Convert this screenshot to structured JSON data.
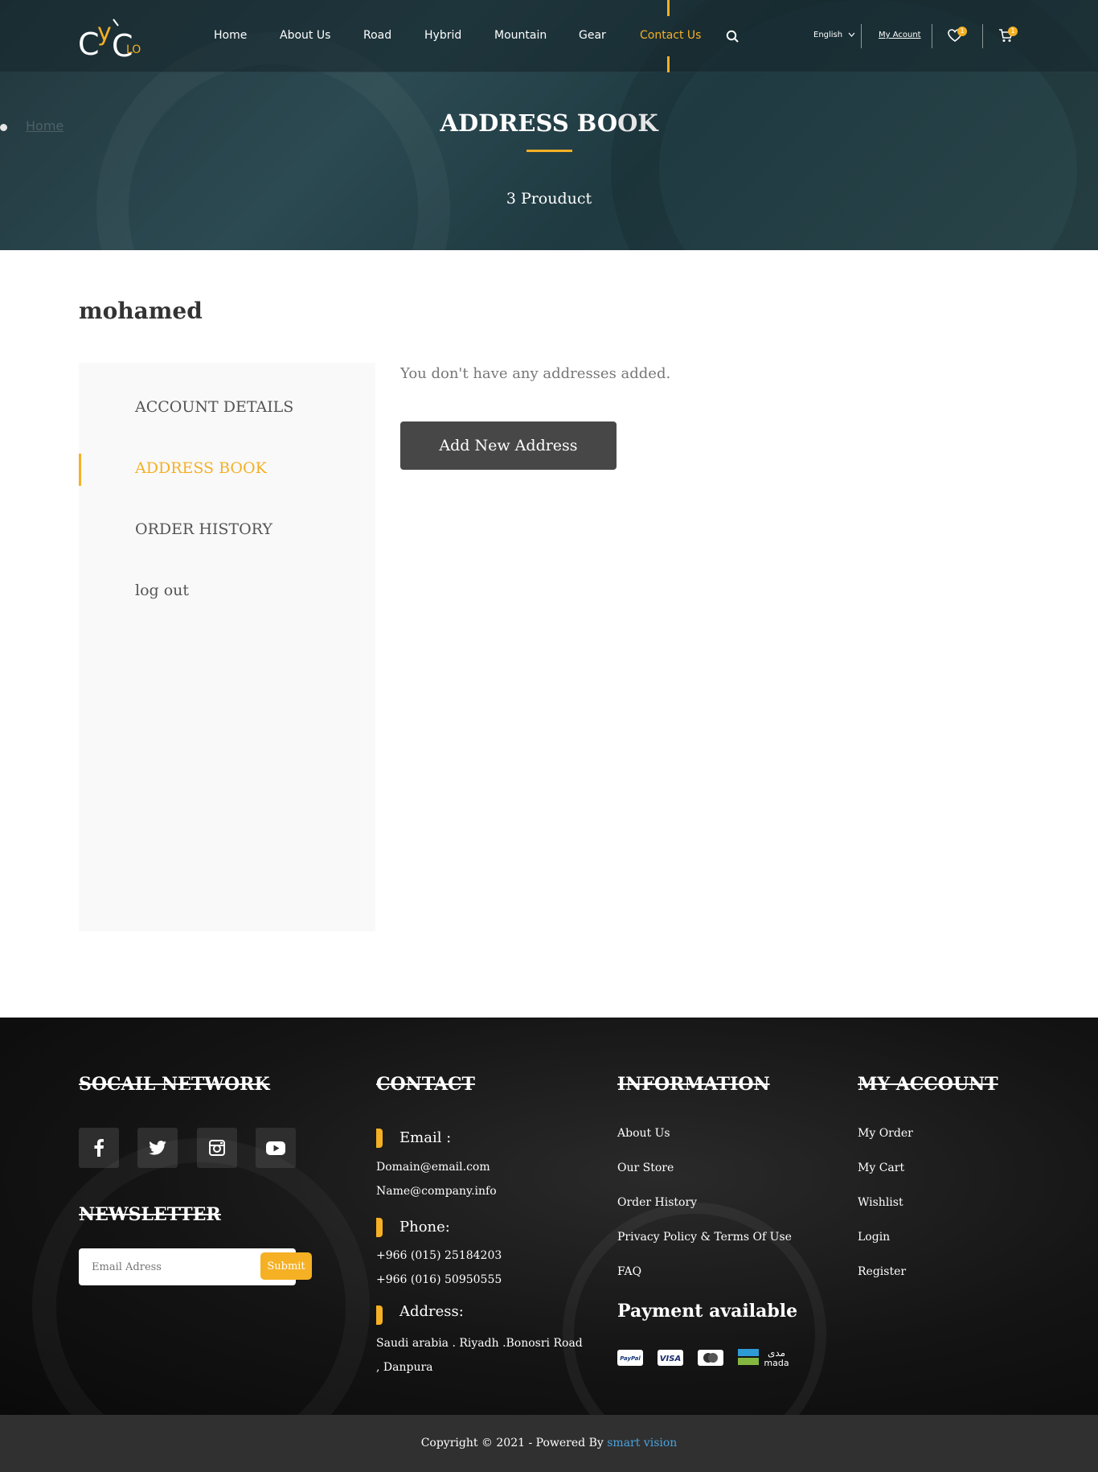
{
  "nav": {
    "items": [
      {
        "label": "Home"
      },
      {
        "label": "About Us"
      },
      {
        "label": "Road"
      },
      {
        "label": "Hybrid"
      },
      {
        "label": "Mountain"
      },
      {
        "label": "Gear"
      },
      {
        "label": "Contact Us",
        "active": true
      }
    ],
    "language": "English",
    "account": "My Acount",
    "wishlist_count": "1",
    "cart_count": "1",
    "accent_color": "#f5b024"
  },
  "logo": {
    "letters": [
      "C",
      "y",
      "C",
      "LO"
    ]
  },
  "breadcrumb": {
    "label": "Home"
  },
  "hero": {
    "title": "ADDRESS BOOK",
    "subtitle": "3 Prouduct"
  },
  "user": {
    "name": "mohamed"
  },
  "sidebar": {
    "items": [
      {
        "label": "ACCOUNT DETAILS"
      },
      {
        "label": "ADDRESS BOOK",
        "active": true
      },
      {
        "label": "ORDER HISTORY"
      },
      {
        "label": "log out"
      }
    ]
  },
  "main": {
    "empty_message": "You don't have any addresses added.",
    "add_button": "Add  New Address"
  },
  "footer": {
    "social_heading": "SOCAIL NETWORK",
    "social_icons": [
      "facebook-icon",
      "twitter-icon",
      "instagram-icon",
      "youtube-icon"
    ],
    "newsletter_heading": "NEWSLETTER",
    "newsletter_placeholder": "Email Adress",
    "newsletter_submit": "Submit",
    "contact_heading": "CONTACT",
    "email_label": "Email :",
    "email_1": "Domain@email.com",
    "email_2": "Name@company.info",
    "phone_label": "Phone:",
    "phone_1": "+966 (015) 25184203",
    "phone_2": "+966 (016) 50950555",
    "address_label": "Address:",
    "address_1": "Saudi arabia . Riyadh .Bonosri Road",
    "address_2": ", Danpura",
    "info_heading": "INFORMATION",
    "info_links": [
      "About Us",
      "Our Store",
      "Order History",
      "Privacy Policy & Terms Of Use",
      "FAQ"
    ],
    "payment_heading": "Payment available",
    "payment_methods": [
      "PayPal",
      "VISA",
      "mastercard-icon",
      "mada"
    ],
    "mada_arabic": "مدى",
    "account_heading": "MY ACCOUNT",
    "account_links": [
      "My Order",
      "My Cart",
      "Wishlist",
      "Login",
      "Register"
    ]
  },
  "copyright": {
    "text": "Copyright © 2021 -  Powered By ",
    "brand": "smart vision"
  }
}
